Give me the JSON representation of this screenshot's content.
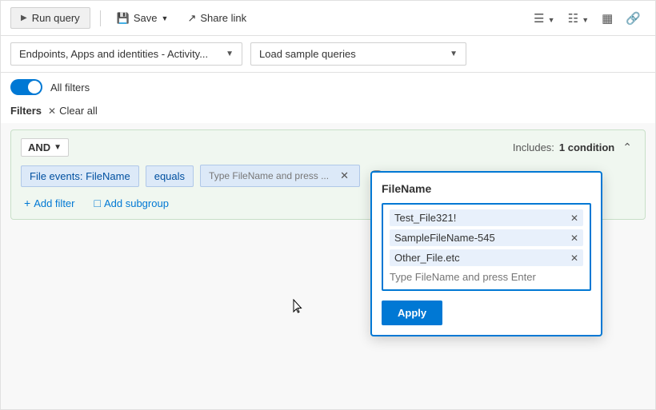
{
  "toolbar": {
    "run_query_label": "Run query",
    "save_label": "Save",
    "share_link_label": "Share link"
  },
  "dropdowns": {
    "left": {
      "label": "Endpoints, Apps and identities - Activity...",
      "placeholder": "Endpoints, Apps and identities - Activity..."
    },
    "right": {
      "label": "Load sample queries",
      "placeholder": "Load sample queries"
    }
  },
  "toggle": {
    "label": "All filters"
  },
  "filters": {
    "label": "Filters",
    "clear_all_label": "Clear all"
  },
  "filter_group": {
    "operator": "AND",
    "includes_label": "Includes:",
    "condition_count": "1 condition",
    "field_label": "File events: FileName",
    "operator_label": "equals",
    "value_placeholder": "Type FileName and press ...",
    "add_filter_label": "Add filter",
    "add_subgroup_label": "Add subgroup"
  },
  "filename_popup": {
    "title": "FileName",
    "tags": [
      {
        "id": 1,
        "text": "Test_File321!"
      },
      {
        "id": 2,
        "text": "SampleFileName-545"
      },
      {
        "id": 3,
        "text": "Other_File.etc"
      }
    ],
    "input_placeholder": "Type FileName and press Enter",
    "apply_label": "Apply"
  }
}
